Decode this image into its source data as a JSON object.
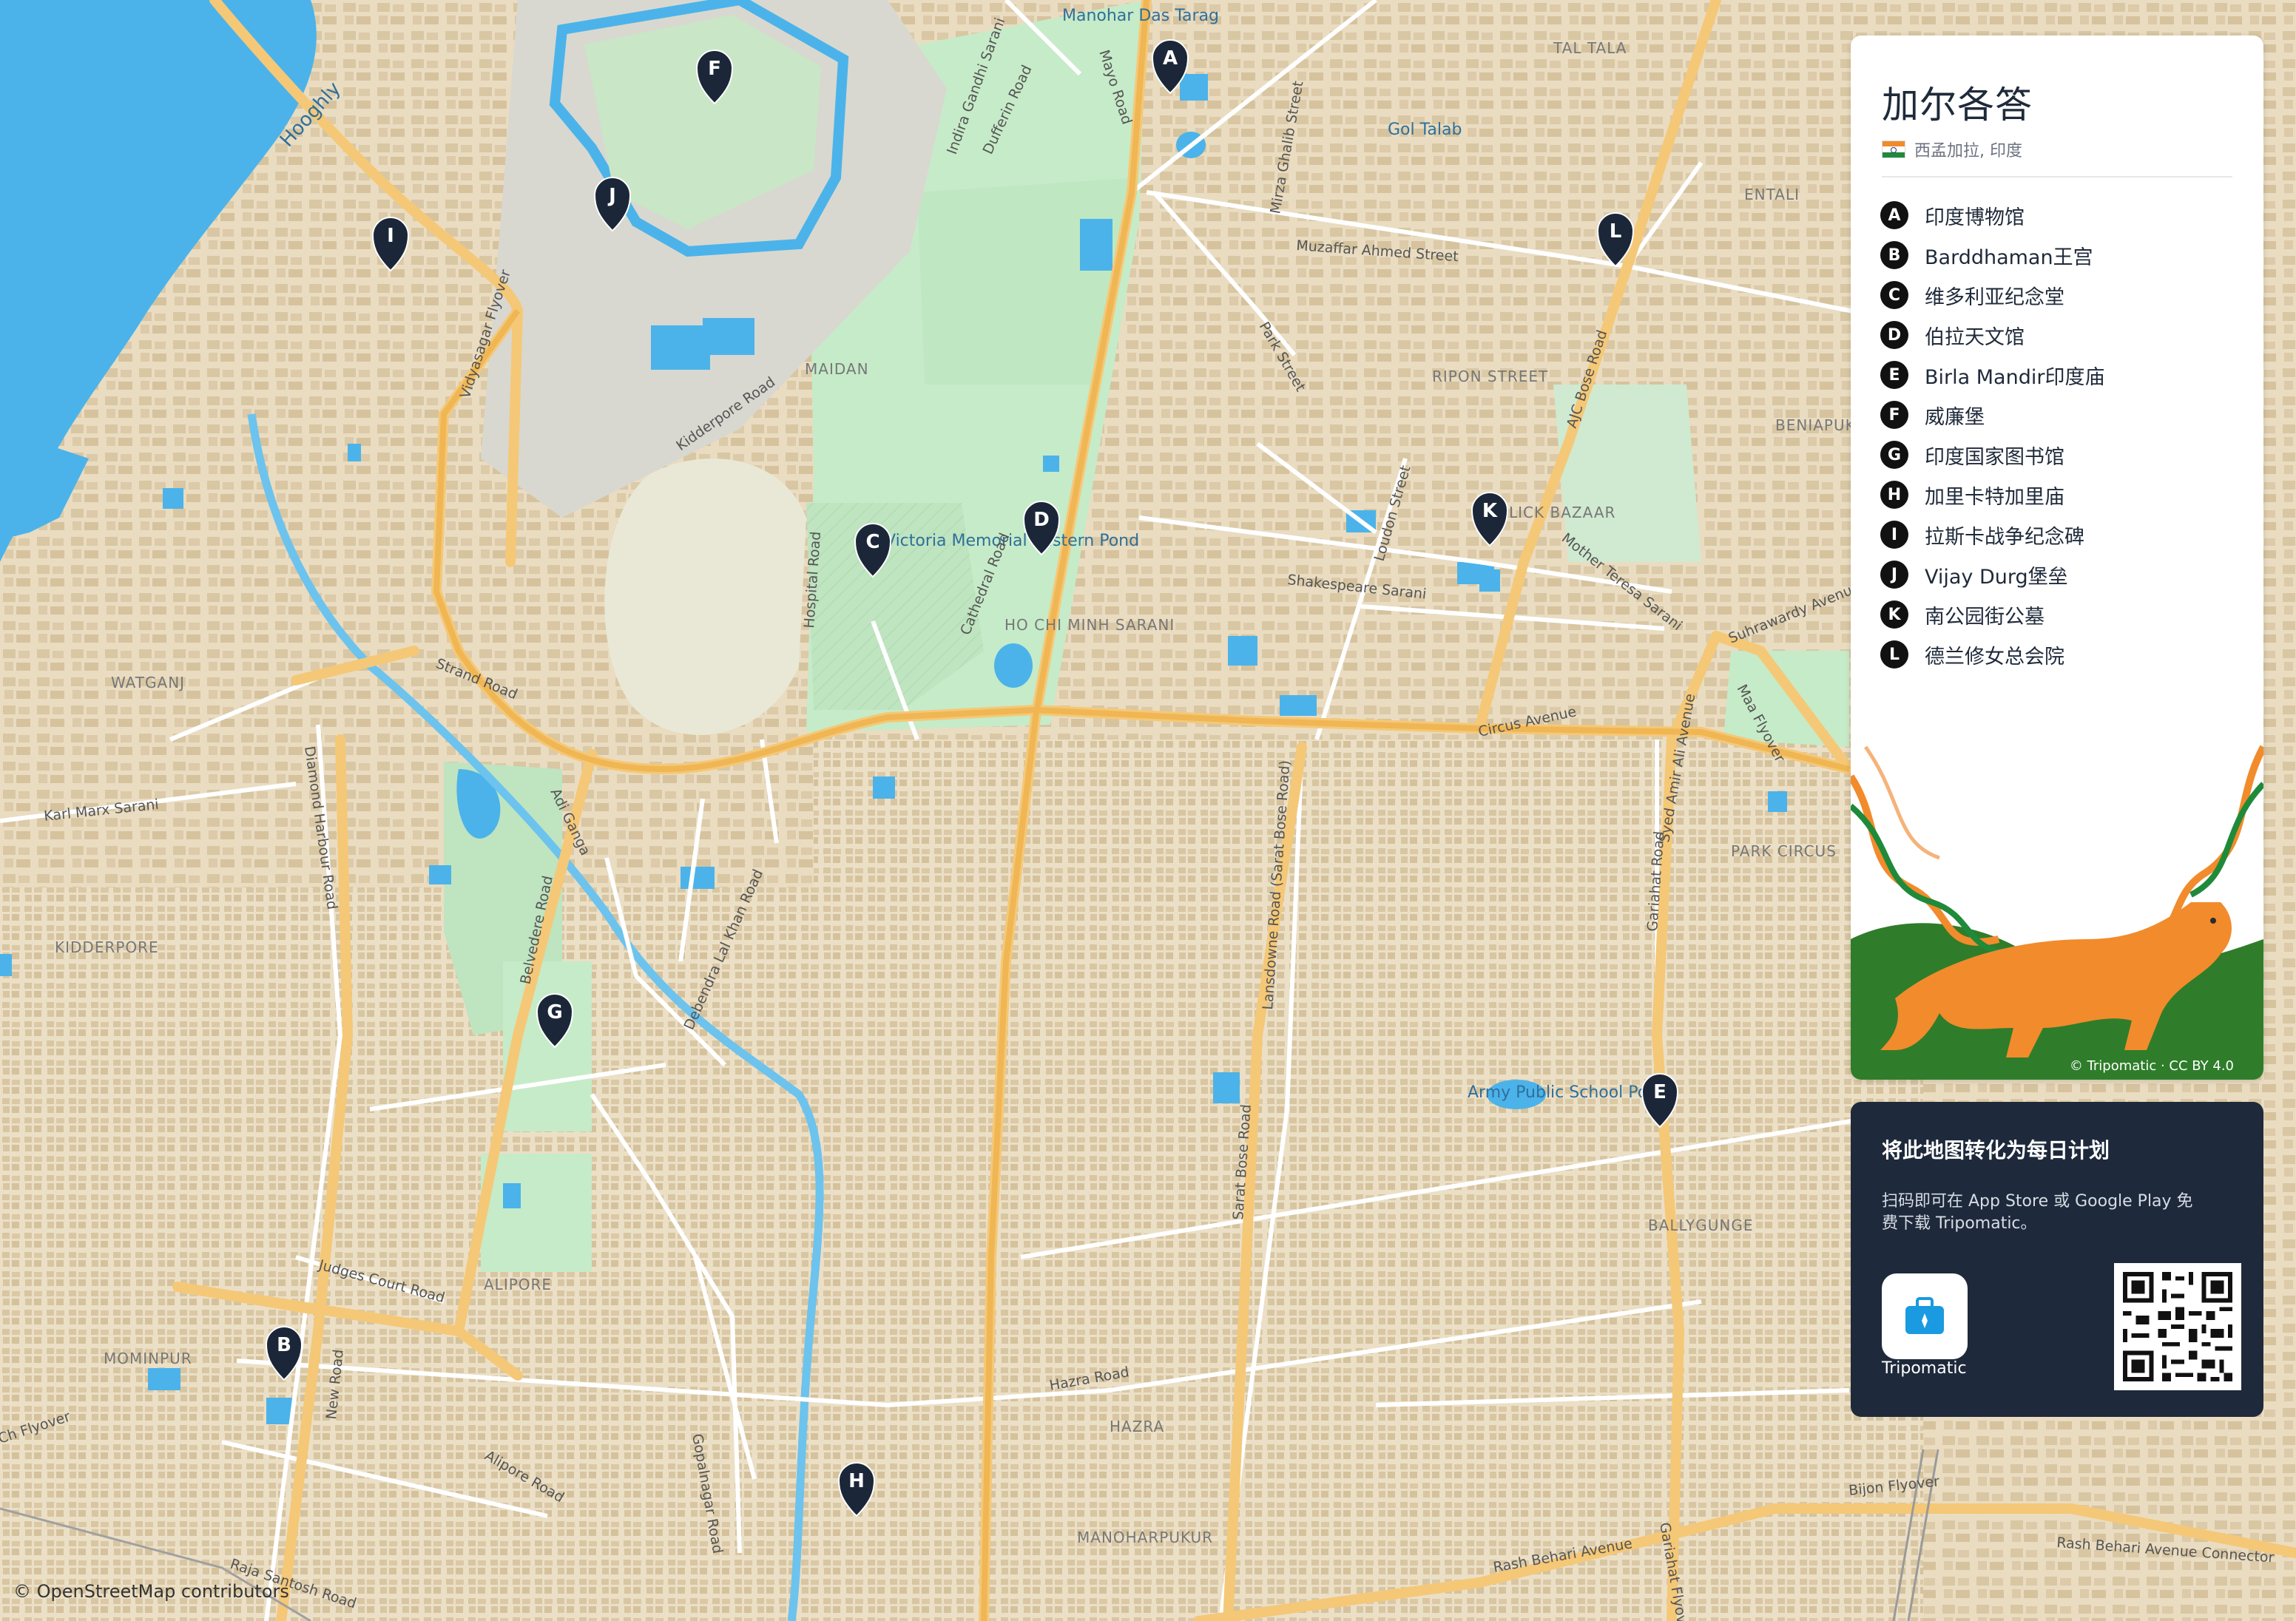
{
  "legend": {
    "title": "加尔各答",
    "subtitle": "西孟加拉, 印度",
    "items": [
      {
        "letter": "A",
        "name": "印度博物馆"
      },
      {
        "letter": "B",
        "name": "Barddhaman王宫"
      },
      {
        "letter": "C",
        "name": "维多利亚纪念堂"
      },
      {
        "letter": "D",
        "name": "伯拉天文馆"
      },
      {
        "letter": "E",
        "name": "Birla Mandir印度庙"
      },
      {
        "letter": "F",
        "name": "威廉堡"
      },
      {
        "letter": "G",
        "name": "印度国家图书馆"
      },
      {
        "letter": "H",
        "name": "加里卡特加里庙"
      },
      {
        "letter": "I",
        "name": "拉斯卡战争纪念碑"
      },
      {
        "letter": "J",
        "name": "Vijay Durg堡垒"
      },
      {
        "letter": "K",
        "name": "南公园街公墓"
      },
      {
        "letter": "L",
        "name": "德兰修女总会院"
      }
    ],
    "credit": "© Tripomatic · CC BY 4.0"
  },
  "promo": {
    "title": "将此地图转化为每日计划",
    "text": "扫码即可在 App Store 或 Google Play 免费下载 Tripomatic。",
    "app_name": "Tripomatic"
  },
  "attribution": "© OpenStreetMap contributors",
  "map": {
    "districts": [
      "TAL TALA",
      "ENTALI",
      "MAIDAN",
      "RIPON STREET",
      "BENIAPUKUR",
      "HO CHI MINH SARANI",
      "WATGANJ",
      "KIDDERPORE",
      "PARK CIRCUS",
      "BALLYGUNGE",
      "ALIPORE",
      "MOMINPUR",
      "HAZRA",
      "MANOHARPUKUR",
      "LICK BAZAAR"
    ],
    "water": [
      "Hooghly",
      "Gol Talab",
      "Army Public School Pond",
      "Victoria Memorial Eastern Pond",
      "Manohar Das Tarag"
    ],
    "roads": [
      "Strand Road",
      "Kidderpore Road",
      "Mayo Road",
      "Indira Gandhi Sarani",
      "Dufferin Road",
      "Mirza Ghalib Street",
      "Park Street",
      "Muzaffar Ahmed Street",
      "AJC Bose Road",
      "Shakespeare Sarani",
      "Loudon Street",
      "Mother Teresa Sarani",
      "Suhrawardy Avenue",
      "Circus Avenue",
      "Maa Flyover",
      "Syed Amir Ali Avenue",
      "Gariahat Road",
      "Hospital Road",
      "Cathedral Road",
      "Adi Ganga",
      "Karl Marx Sarani",
      "Diamond Harbour Road",
      "Belvedere Road",
      "Debendra Lal Khan Road",
      "Lansdowne Road (Sarat Bose Road)",
      "Sarat Bose Road",
      "Judges Court Road",
      "Hazra Road",
      "Alipore Road",
      "Gopalnagar Road",
      "Rash Behari Avenue",
      "Bijon Flyover",
      "Rash Behari Avenue Connector",
      "Gariahat Flyover",
      "New Road",
      "Raja Santosh Road",
      "Vidyasagar Flyover",
      "Ch Flyover"
    ]
  }
}
